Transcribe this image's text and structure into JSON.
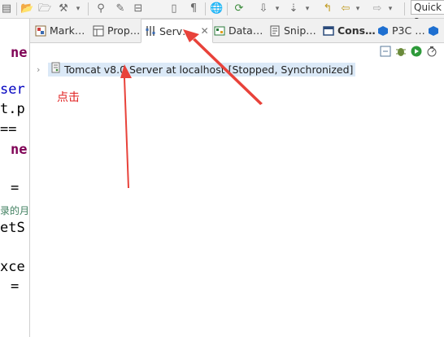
{
  "toolbar": {
    "icons": [
      "open-folder-icon",
      "open-file-icon",
      "wrench-icon",
      "pin-icon",
      "pencil-icon",
      "document-icon",
      "paragraph-icon",
      "globe-icon",
      "run-icon",
      "down-arrow-icon",
      "next-icon",
      "back-icon",
      "forward-icon"
    ],
    "quick_access": "Quick a"
  },
  "editor": {
    "lines": [
      "ne",
      "ser",
      "t.p",
      "==",
      "ne",
      "=",
      "录的月",
      "etS",
      "xce",
      "="
    ]
  },
  "tabs": [
    {
      "label": "Mark…",
      "icon": "markers-icon"
    },
    {
      "label": "Prop…",
      "icon": "properties-icon"
    },
    {
      "label": "Serv…",
      "icon": "servers-icon",
      "active": true
    },
    {
      "label": "Data…",
      "icon": "data-source-icon"
    },
    {
      "label": "Snip…",
      "icon": "snippets-icon"
    },
    {
      "label": "Cons…",
      "icon": "console-icon",
      "bold": true
    },
    {
      "label": "P3C …",
      "icon": "p3c-icon"
    }
  ],
  "server": {
    "name": "Tomcat v8.0 Server at localhost",
    "status": "[Stopped, Synchronized]"
  },
  "annotation": "点击",
  "colors": {
    "arrow": "#e8423a",
    "selection": "#dbe9f7",
    "annotation": "#e02020"
  }
}
